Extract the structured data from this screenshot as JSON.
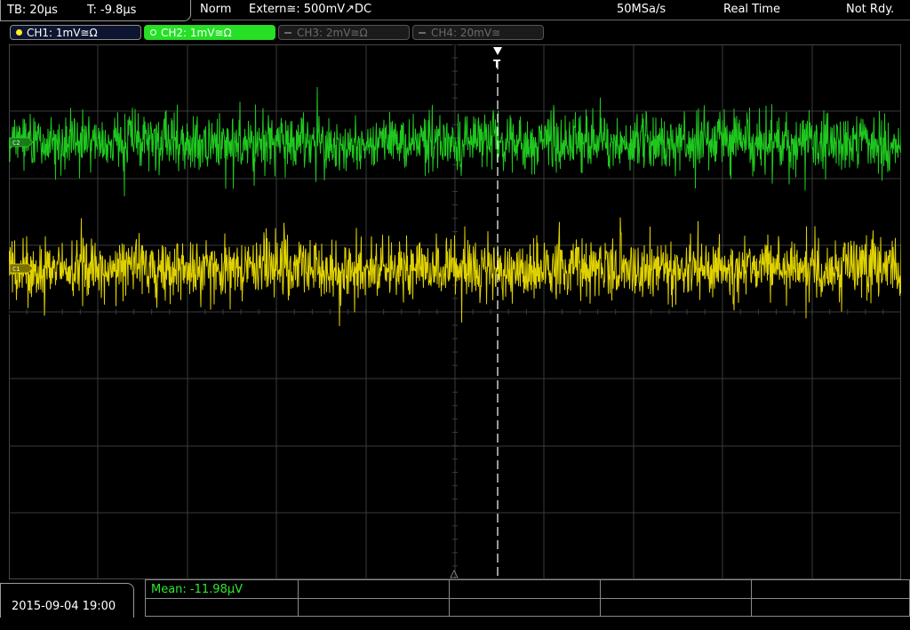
{
  "timebase": {
    "tb": "TB: 20µs",
    "trigger_offset": "T: -9.8µs"
  },
  "status": {
    "mode": "Norm",
    "trigger": "Extern≅: 500mV↗DC",
    "sample_rate": "50MSa/s",
    "acq_mode": "Real Time",
    "state": "Not Rdy."
  },
  "channels": [
    {
      "label": "CH1: 1mV≅Ω",
      "color": "#ffee20",
      "active": true
    },
    {
      "label": "CH2: 1mV≅Ω",
      "color": "#25e025",
      "active": true
    },
    {
      "label": "CH3: 2mV≅Ω",
      "color": "#6a6a6a",
      "active": false
    },
    {
      "label": "CH4: 20mV≅",
      "color": "#6a6a6a",
      "active": false
    }
  ],
  "markers": {
    "ch1": "C1",
    "ch2": "C2",
    "trigger": "T"
  },
  "colors": {
    "ch1_trace": "#e0d200",
    "ch2_trace": "#1fc81f",
    "grid": "#3a3a3a",
    "trigger_line": "#ffffff"
  },
  "measurement": {
    "mean": "Mean: -11.98µV"
  },
  "datetime": "2015-09-04 19:00"
}
